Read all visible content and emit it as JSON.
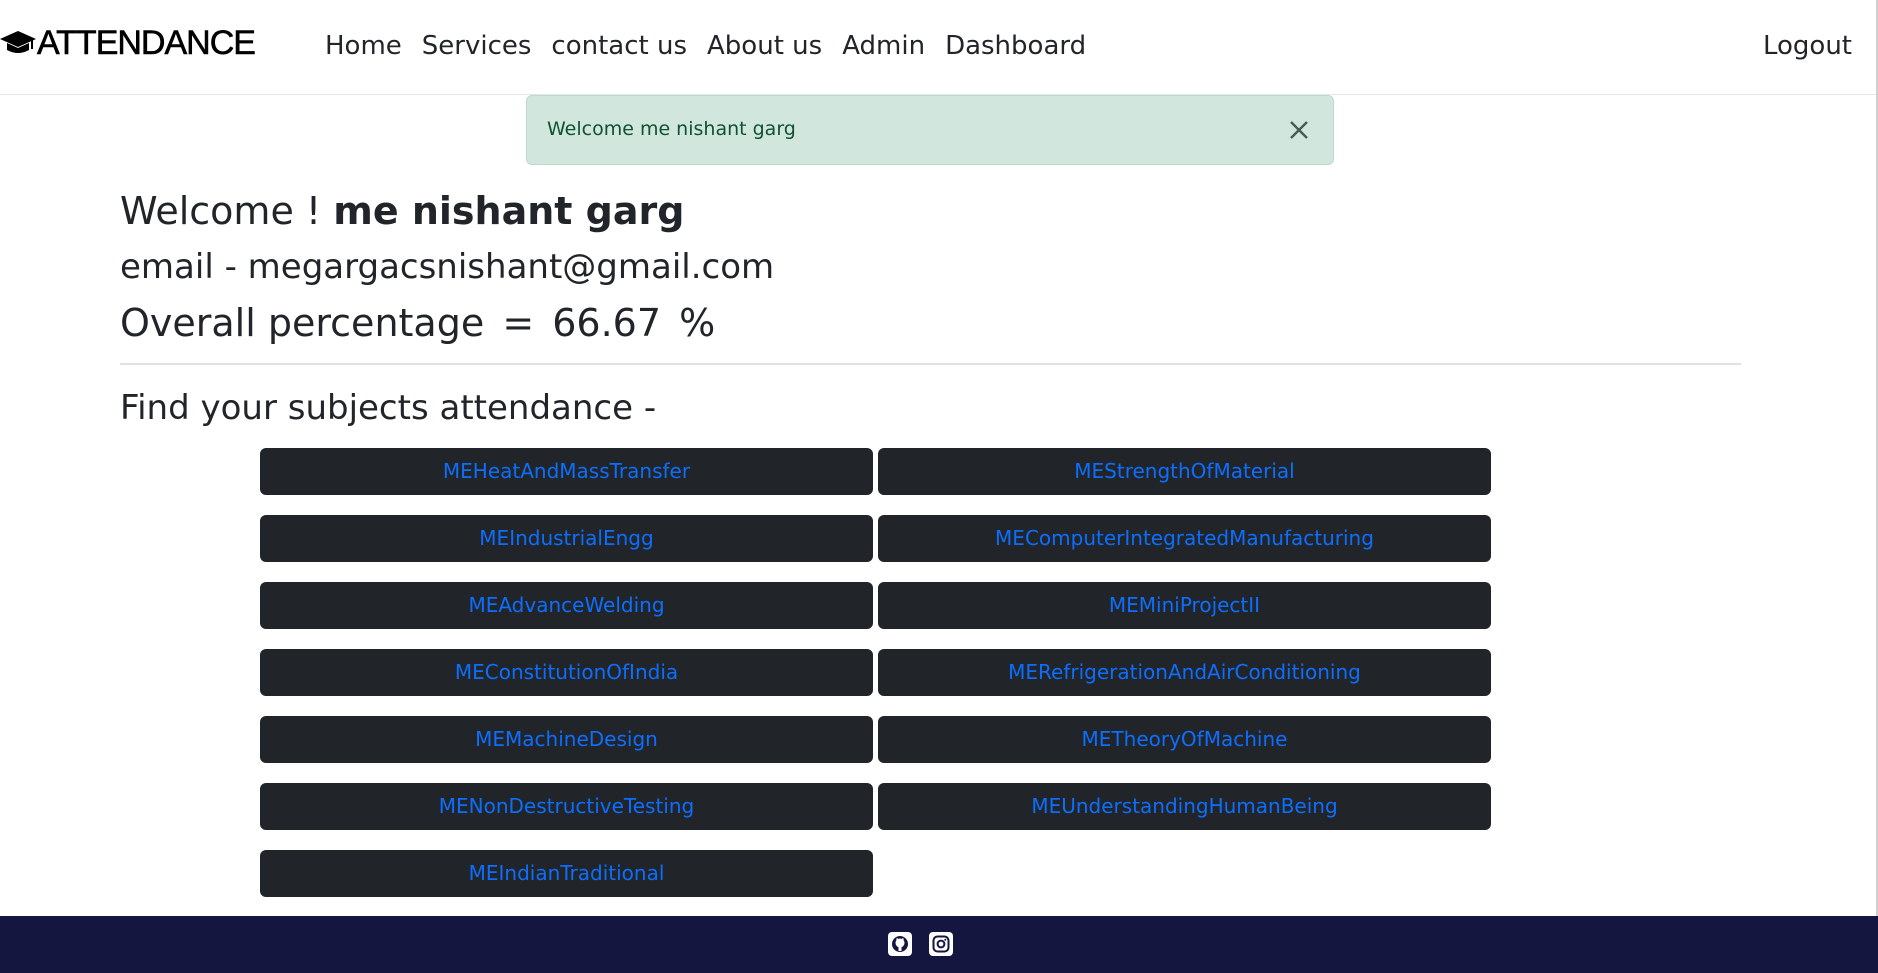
{
  "brand": {
    "text": "ATTENDANCE",
    "icon": "graduation-cap-icon"
  },
  "nav": {
    "links": [
      "Home",
      "Services",
      "contact us",
      "About us",
      "Admin",
      "Dashboard"
    ],
    "logout": "Logout"
  },
  "alert": {
    "message": "Welcome me nishant garg",
    "close_icon": "close-icon"
  },
  "profile": {
    "welcome_prefix": "Welcome !",
    "name": "me nishant garg",
    "email_label": "email - megargacsnishant@gmail.com",
    "overall_label": "Overall percentage",
    "overall_eq": "=",
    "overall_value": "66.67",
    "overall_unit": "%"
  },
  "subjects": {
    "heading": "Find your subjects attendance -",
    "items": [
      "MEHeatAndMassTransfer",
      "MEStrengthOfMaterial",
      "MEIndustrialEngg",
      "MEComputerIntegratedManufacturing",
      "MEAdvanceWelding",
      "MEMiniProjectII",
      "MEConstitutionOfIndia",
      "MERefrigerationAndAirConditioning",
      "MEMachineDesign",
      "METheoryOfMachine",
      "MENonDestructiveTesting",
      "MEUnderstandingHumanBeing",
      "MEIndianTraditional"
    ]
  },
  "footer": {
    "icons": [
      "github-icon",
      "instagram-icon"
    ]
  },
  "colors": {
    "footer_bg": "#15163f",
    "button_bg": "#212529",
    "link": "#0d6efd",
    "alert_bg": "#d1e7dd"
  }
}
